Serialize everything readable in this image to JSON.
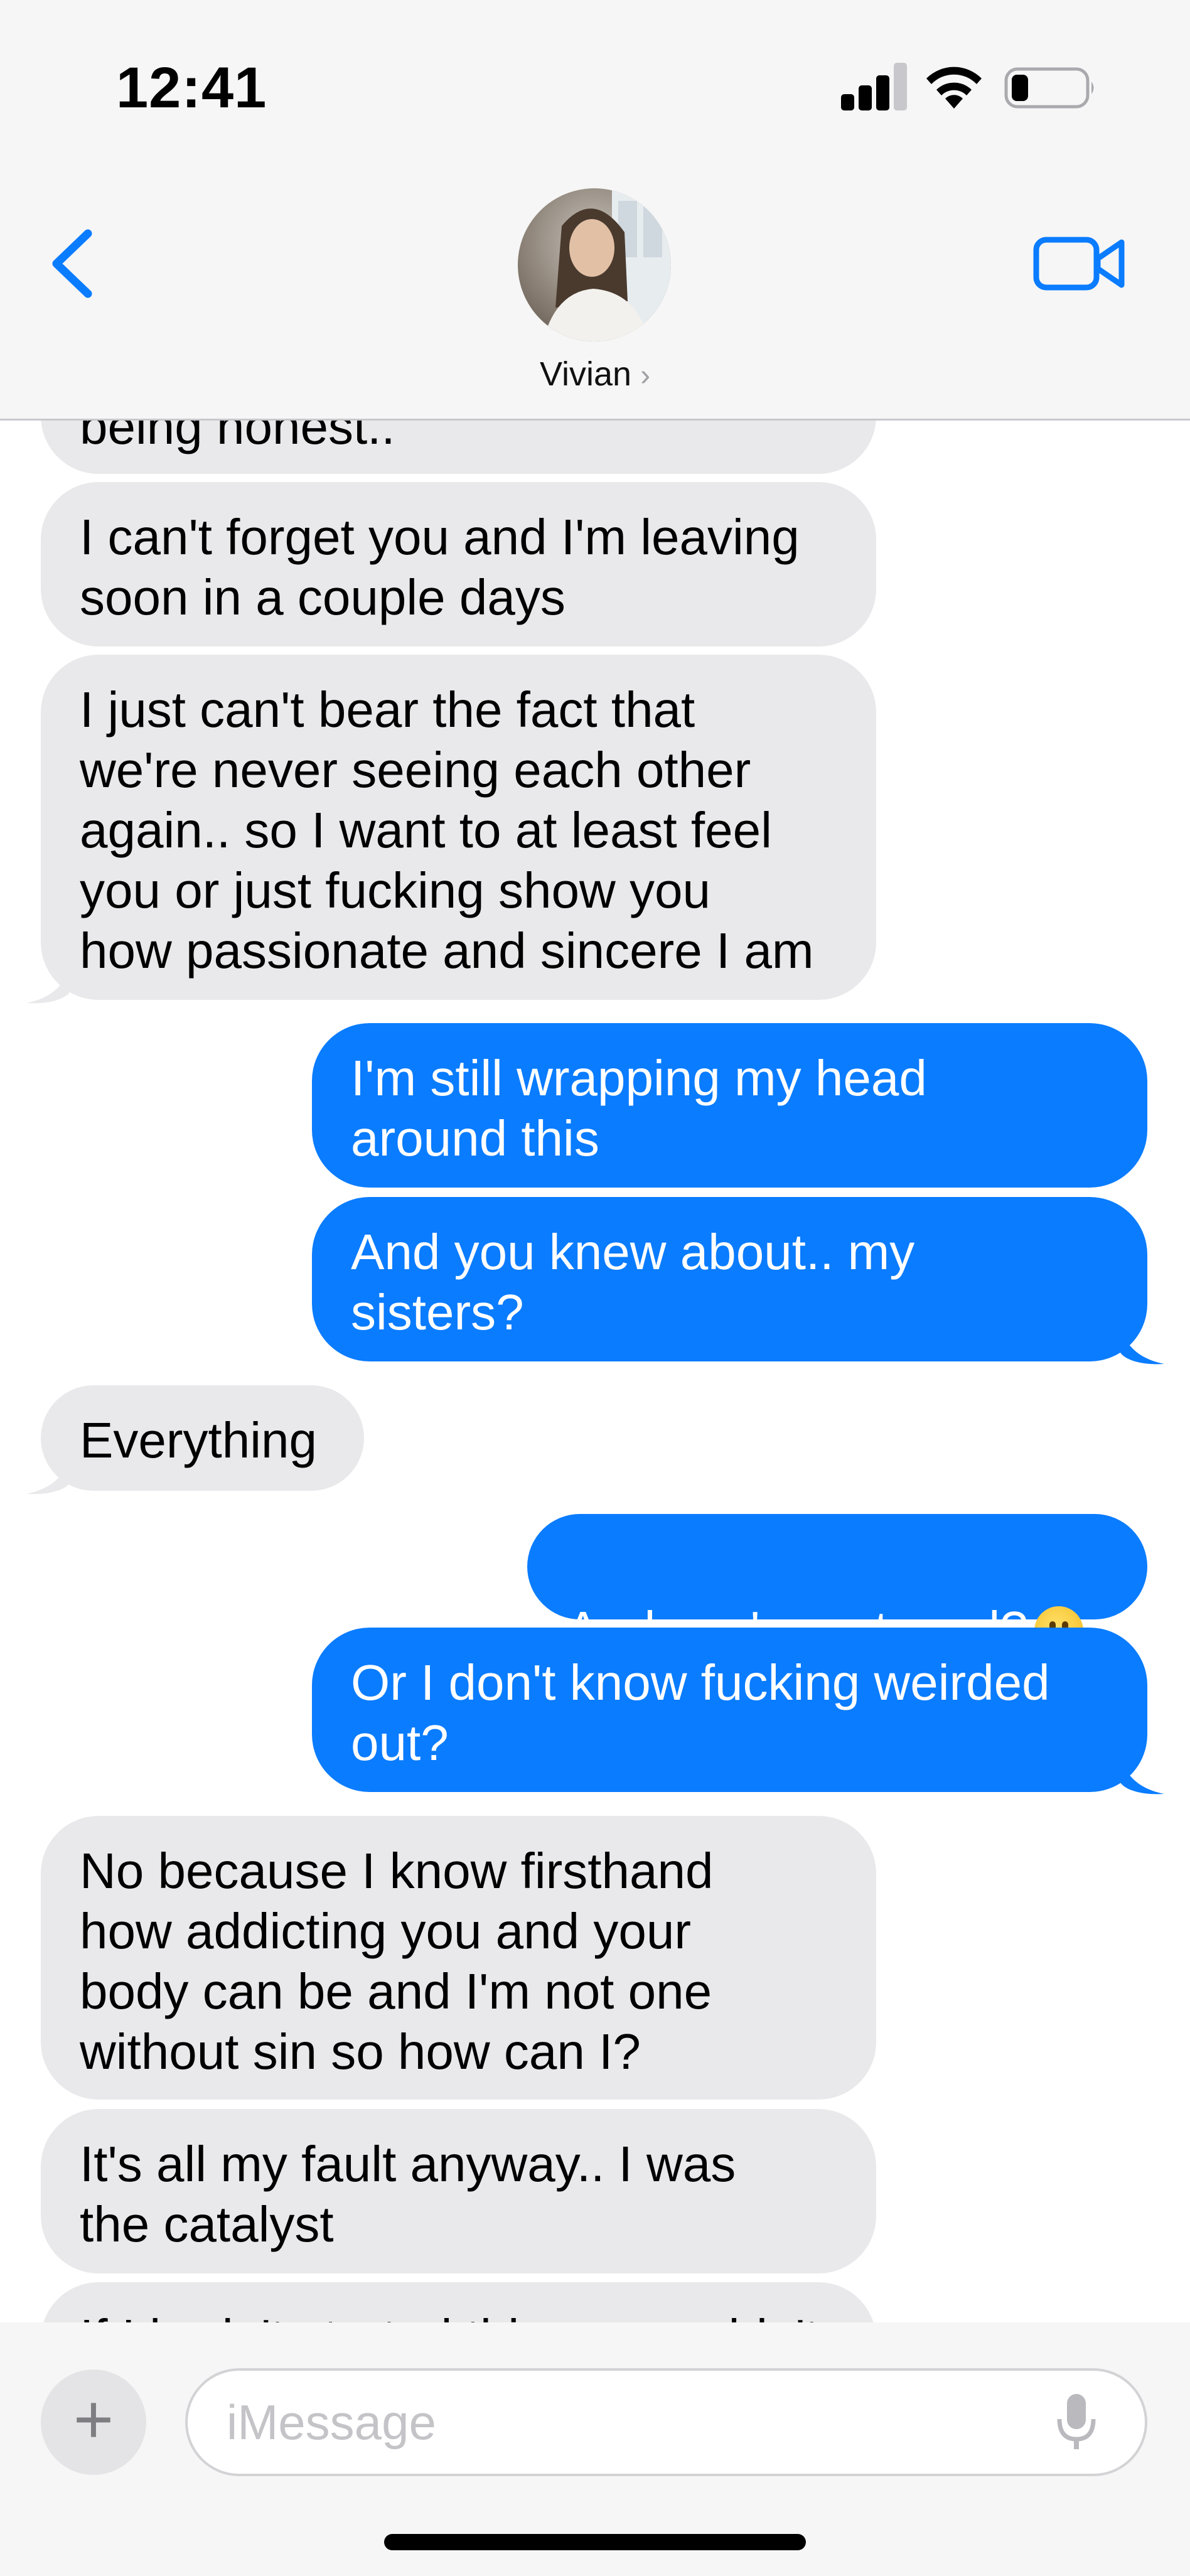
{
  "status_bar": {
    "time": "12:41",
    "battery_level": 0.2
  },
  "header": {
    "contact_name": "Vivian",
    "contact_chevron": "›",
    "icons": [
      "back-chevron-icon",
      "video-call-icon"
    ]
  },
  "conversation": {
    "messages": [
      {
        "sender": "contact",
        "text": "being honest.."
      },
      {
        "sender": "contact",
        "text": "I can't forget you and I'm leaving\nsoon in a couple days"
      },
      {
        "sender": "contact",
        "text": "I just can't bear the fact that\nwe're never seeing each other\nagain.. so I want to at least feel\nyou or just fucking show you\nhow passionate and sincere I am"
      },
      {
        "sender": "me",
        "text": "I'm still wrapping my head\naround this"
      },
      {
        "sender": "me",
        "text": "And you knew about.. my\nsisters?"
      },
      {
        "sender": "contact",
        "text": "Everything"
      },
      {
        "sender": "me",
        "text": "And you're not mad?",
        "emoji": "face-without-mouth"
      },
      {
        "sender": "me",
        "text": "Or I don't know fucking weirded\nout?"
      },
      {
        "sender": "contact",
        "text": "No because I know firsthand\nhow addicting you and your\nbody can be and I'm not one\nwithout sin so how can I?"
      },
      {
        "sender": "contact",
        "text": "It's all my fault anyway.. I was\nthe catalyst"
      },
      {
        "sender": "contact",
        "text": "If I hadn't started this we wouldn't"
      }
    ]
  },
  "input_bar": {
    "plus_label": "+",
    "placeholder": "iMessage"
  },
  "colors": {
    "sent_bubble": "#0a7cff",
    "received_bubble": "#e9e9eb",
    "accent": "#0a7cff",
    "header_bg": "#f6f6f6"
  }
}
